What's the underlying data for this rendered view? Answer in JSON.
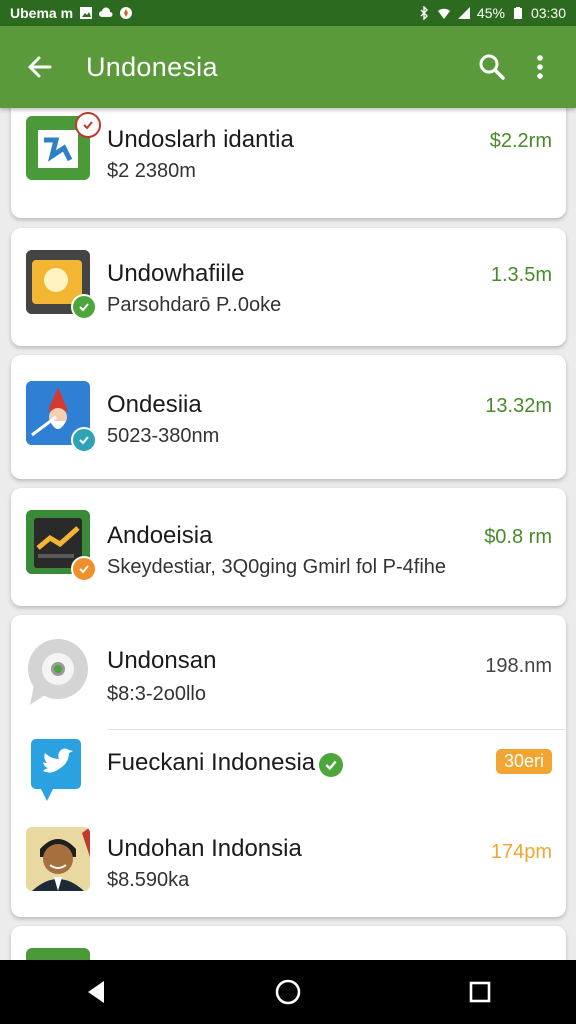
{
  "status_bar": {
    "carrier": "Ubema m",
    "battery": "45%",
    "time": "03:30",
    "icons": [
      "image-icon",
      "cloud-icon",
      "compass-icon",
      "bluetooth-icon",
      "wifi-icon",
      "signal-icon",
      "battery-icon"
    ]
  },
  "app_bar": {
    "title": "Undonesia",
    "back_icon": "arrow-left-icon",
    "search_icon": "search-icon",
    "more_icon": "more-vert-icon",
    "color": "#5a9a3a"
  },
  "items": [
    {
      "name": "Undoslarh idantia",
      "sub": "$2 2380m",
      "value": "$2.2rm",
      "value_color": "#4a8a2a"
    },
    {
      "name": "Undowhafiile",
      "sub": "Parsohdarō P..0oke",
      "value": "1.3.5m",
      "value_color": "#4a8a2a"
    },
    {
      "name": "Ondesiia",
      "sub": "5023-380nm",
      "value": "13.32m",
      "value_color": "#4a8a2a"
    },
    {
      "name": "Andoeisia",
      "sub": "Skeydestiar, 3Q0ging Gmirl fol P-4fihe",
      "value": "$0.8 rm",
      "value_color": "#4a8a2a"
    },
    {
      "name": "Undonsan",
      "sub": "$8:3-2o0llo",
      "value": "198.nm",
      "value_color": "#444444"
    },
    {
      "name": "Fueckani Indonesia",
      "sub": "",
      "value": "30eri",
      "value_color": "#f2a531"
    },
    {
      "name": "Undohan Indonsia",
      "sub": "$8.590ka",
      "value": "174pm",
      "value_color": "#f2a531"
    }
  ],
  "nav_bar": {
    "back_icon": "triangle-back-icon",
    "home_icon": "circle-home-icon",
    "recents_icon": "square-recents-icon"
  }
}
